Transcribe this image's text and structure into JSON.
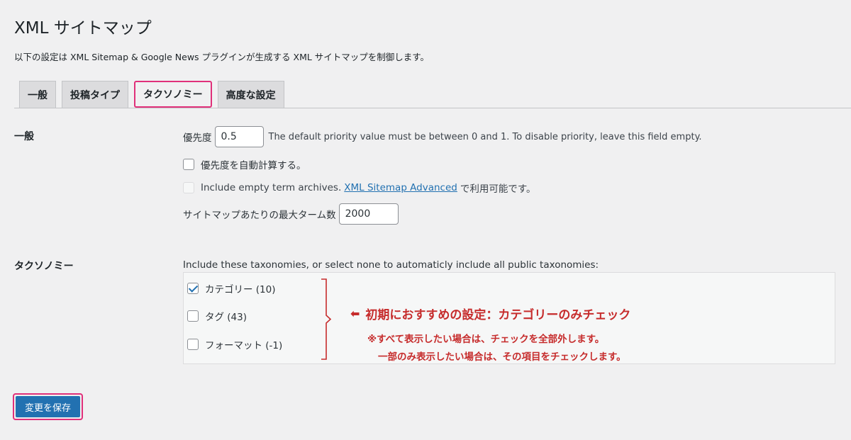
{
  "page": {
    "title": "XML サイトマップ",
    "intro": "以下の設定は XML Sitemap & Google News プラグインが生成する XML サイトマップを制御します。"
  },
  "tabs": [
    {
      "label": "一般",
      "active": false
    },
    {
      "label": "投稿タイプ",
      "active": false
    },
    {
      "label": "タクソノミー",
      "active": true
    },
    {
      "label": "高度な設定",
      "active": false
    }
  ],
  "general": {
    "section_label": "一般",
    "priority_label": "優先度",
    "priority_value": "0.5",
    "priority_desc": "The default priority value must be between 0 and 1. To disable priority, leave this field empty.",
    "auto_priority_label": "優先度を自動計算する。",
    "auto_priority_checked": false,
    "empty_terms_label": "Include empty term archives.",
    "empty_terms_link": "XML Sitemap Advanced",
    "empty_terms_suffix": "で利用可能です。",
    "max_terms_label": "サイトマップあたりの最大ターム数",
    "max_terms_value": "2000"
  },
  "taxonomies": {
    "section_label": "タクソノミー",
    "desc": "Include these taxonomies, or select none to automaticly include all public taxonomies:",
    "items": [
      {
        "label": "カテゴリー (10)",
        "checked": true
      },
      {
        "label": "タグ (43)",
        "checked": false
      },
      {
        "label": "フォーマット (-1)",
        "checked": false
      }
    ]
  },
  "annotation": {
    "main": "初期におすすめの設定：カテゴリーのみチェック",
    "sub1": "※すべて表示したい場合は、チェックを全部外します。",
    "sub2": "一部のみ表示したい場合は、その項目をチェックします。",
    "arrow_icon": "arrow-left-icon",
    "color": "#c62c2c"
  },
  "save_button": "変更を保存",
  "colors": {
    "accent": "#2271b1",
    "highlight": "#e0307a"
  }
}
